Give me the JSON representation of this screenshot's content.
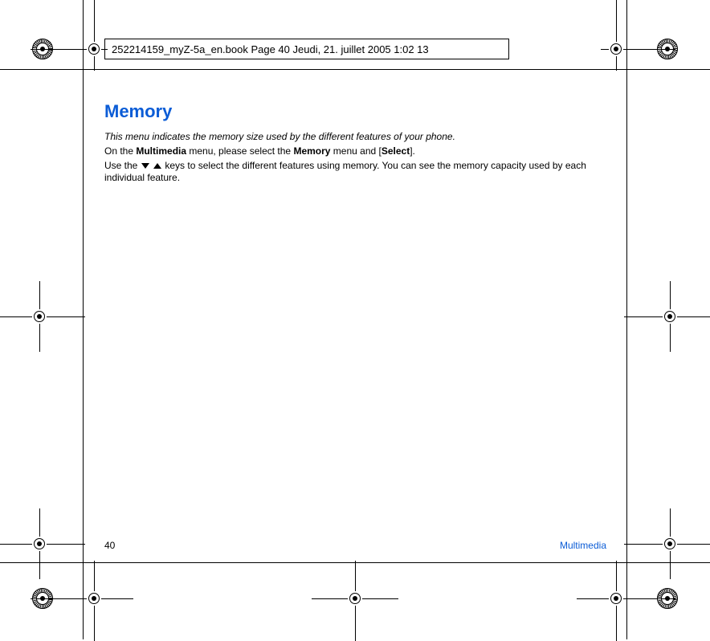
{
  "header": {
    "text": "252214159_myZ-5a_en.book  Page 40  Jeudi, 21. juillet 2005  1:02 13"
  },
  "content": {
    "title": "Memory",
    "intro": "This menu indicates the memory size used by the different features of your phone.",
    "line2_pre": "On the ",
    "line2_bold1": "Multimedia",
    "line2_mid": " menu, please select the ",
    "line2_bold2": "Memory",
    "line2_mid2": " menu and [",
    "line2_bold3": "Select",
    "line2_post": "].",
    "line3_pre": "Use the ",
    "line3_post": " keys to select the different features using memory. You can see the memory capacity used by each individual feature."
  },
  "footer": {
    "page": "40",
    "section": "Multimedia"
  }
}
